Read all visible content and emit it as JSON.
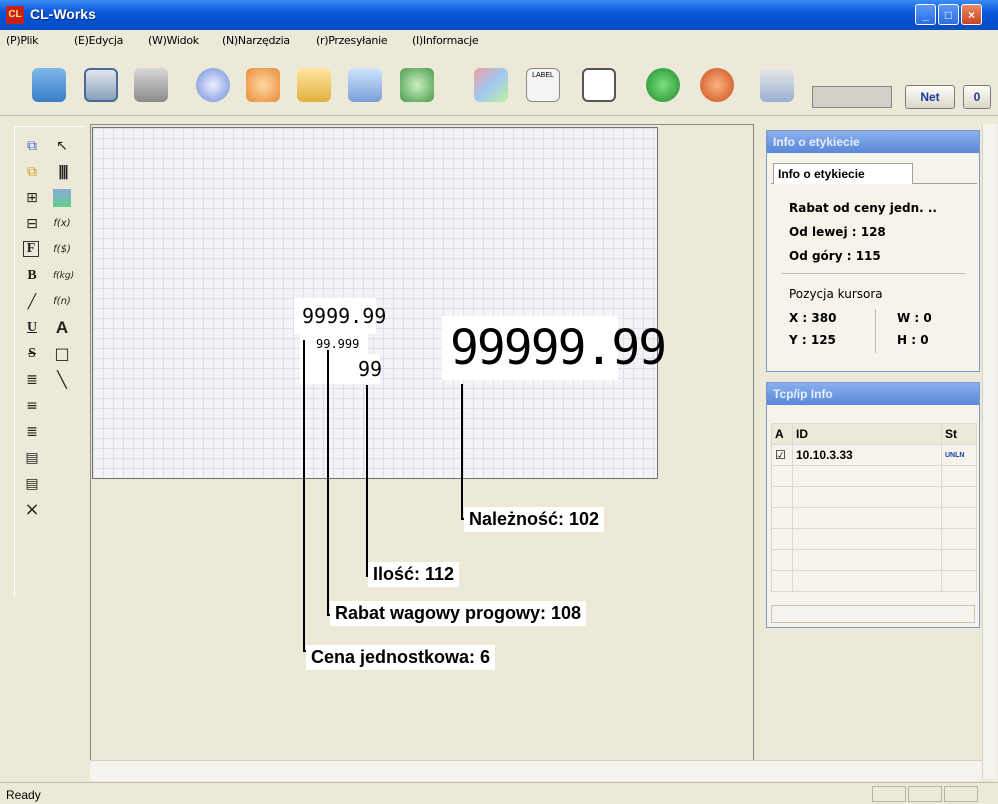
{
  "window": {
    "title": "CL-Works",
    "app_icon": "cl-works-logo",
    "app_icon_text": "CL"
  },
  "menu": [
    "(P)Plik",
    "(E)Edycja",
    "(W)Widok",
    "(N)Narzędzia",
    "(r)Przesyłanie",
    "(I)Informacje"
  ],
  "toolbar": {
    "buttons": [
      "open-folder-icon",
      "save-icon",
      "print-icon",
      "scale-icon",
      "star-icon",
      "upload-icon",
      "download-icon",
      "network-icon",
      "grid-icon",
      "label-icon",
      "ruler-icon",
      "go-icon",
      "back-icon",
      "settings-icon"
    ],
    "label_button_text": "LABEL",
    "net_label": "Net",
    "zero_label": "0"
  },
  "left_tools": {
    "col1": [
      "front-icon",
      "back-icon",
      "group-icon",
      "ungroup-icon",
      "F",
      "B",
      "pen-icon",
      "U",
      "S",
      "align-left-icon",
      "align-center-icon",
      "align-right-icon",
      "justify-icon",
      "list-icon",
      "×"
    ],
    "col2": [
      "cursor-icon",
      "barcode-icon",
      "image-icon",
      "f(x)",
      "f($)",
      "f(kg)",
      "f(n)",
      "A",
      "rectangle-icon",
      "line-icon"
    ]
  },
  "canvas_fields": {
    "f1": "9999.99",
    "f2": "99.999",
    "f3": "99",
    "f4": "99999.99"
  },
  "callouts": {
    "naleznosc": "Należność: 102",
    "ilosc": "Ilość: 112",
    "rabat": "Rabat wagowy progowy: 108",
    "cena": "Cena jednostkowa: 6"
  },
  "info_panel": {
    "header": "Info o etykiecie",
    "tab": "Info o etykiecie",
    "name": "Rabat od ceny jedn. ..",
    "left": "Od lewej : 128",
    "top": "Od góry : 115",
    "cursor_title": "Pozycja kursora",
    "x": "X : 380",
    "w": "W : 0",
    "y": "Y : 125",
    "h": "H : 0"
  },
  "tcp_panel": {
    "header": "Tcp/ip Info",
    "columns": [
      "A",
      "ID",
      "St"
    ],
    "rows": [
      {
        "checked": "☑",
        "id": "10.10.3.33",
        "status": "UNLN"
      }
    ]
  },
  "status": {
    "text": "Ready"
  },
  "colors": {
    "titlebar": "#0550d0",
    "panel_head": "#5a88d8",
    "background": "#ece9d8"
  }
}
